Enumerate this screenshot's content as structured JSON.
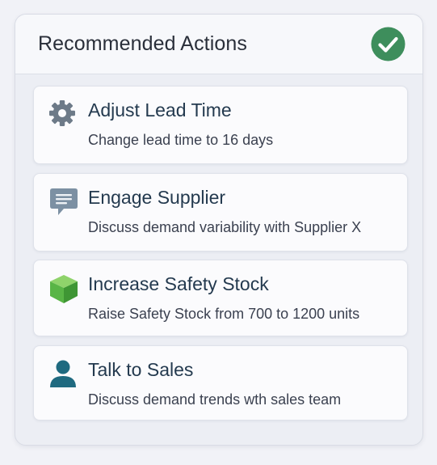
{
  "panel": {
    "title": "Recommended Actions",
    "status_icon": "check-circle-icon",
    "accent_color": "#3e8e5c"
  },
  "actions": [
    {
      "icon": "gear-icon",
      "icon_color": "#6d7a88",
      "title": "Adjust Lead Time",
      "description": "Change lead time to 16 days"
    },
    {
      "icon": "chat-icon",
      "icon_color": "#7c90a3",
      "title": "Engage Supplier",
      "description": "Discuss demand variability with Supplier X"
    },
    {
      "icon": "cube-icon",
      "icon_color": "#5ab546",
      "title": "Increase Safety Stock",
      "description": "Raise Safety Stock from 700 to 1200 units"
    },
    {
      "icon": "person-icon",
      "icon_color": "#1f6a80",
      "title": "Talk to Sales",
      "description": "Discuss demand trends wth sales team"
    }
  ]
}
